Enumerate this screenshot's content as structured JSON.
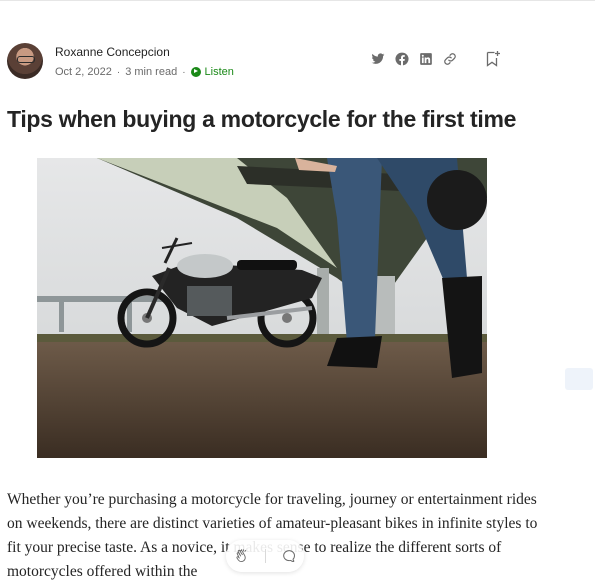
{
  "article": {
    "author_name": "Roxanne Concepcion",
    "date": "Oct 2, 2022",
    "read_time": "3 min read",
    "separator": "·",
    "listen_label": "Listen",
    "title": "Tips when buying a motorcycle for the first time",
    "body": "Whether you’re purchasing a motorcycle for traveling, journey or entertainment rides on weekends, there are distinct varieties of amateur-pleasant bikes in infinite styles to fit your precise taste. As a novice, it makes sense to realize the different sorts of motorcycles offered within the"
  },
  "share_icons": [
    "twitter-icon",
    "facebook-icon",
    "linkedin-icon",
    "link-icon"
  ],
  "colors": {
    "accent": "#1a8917",
    "text": "#242424",
    "muted": "#6b6b6b"
  }
}
